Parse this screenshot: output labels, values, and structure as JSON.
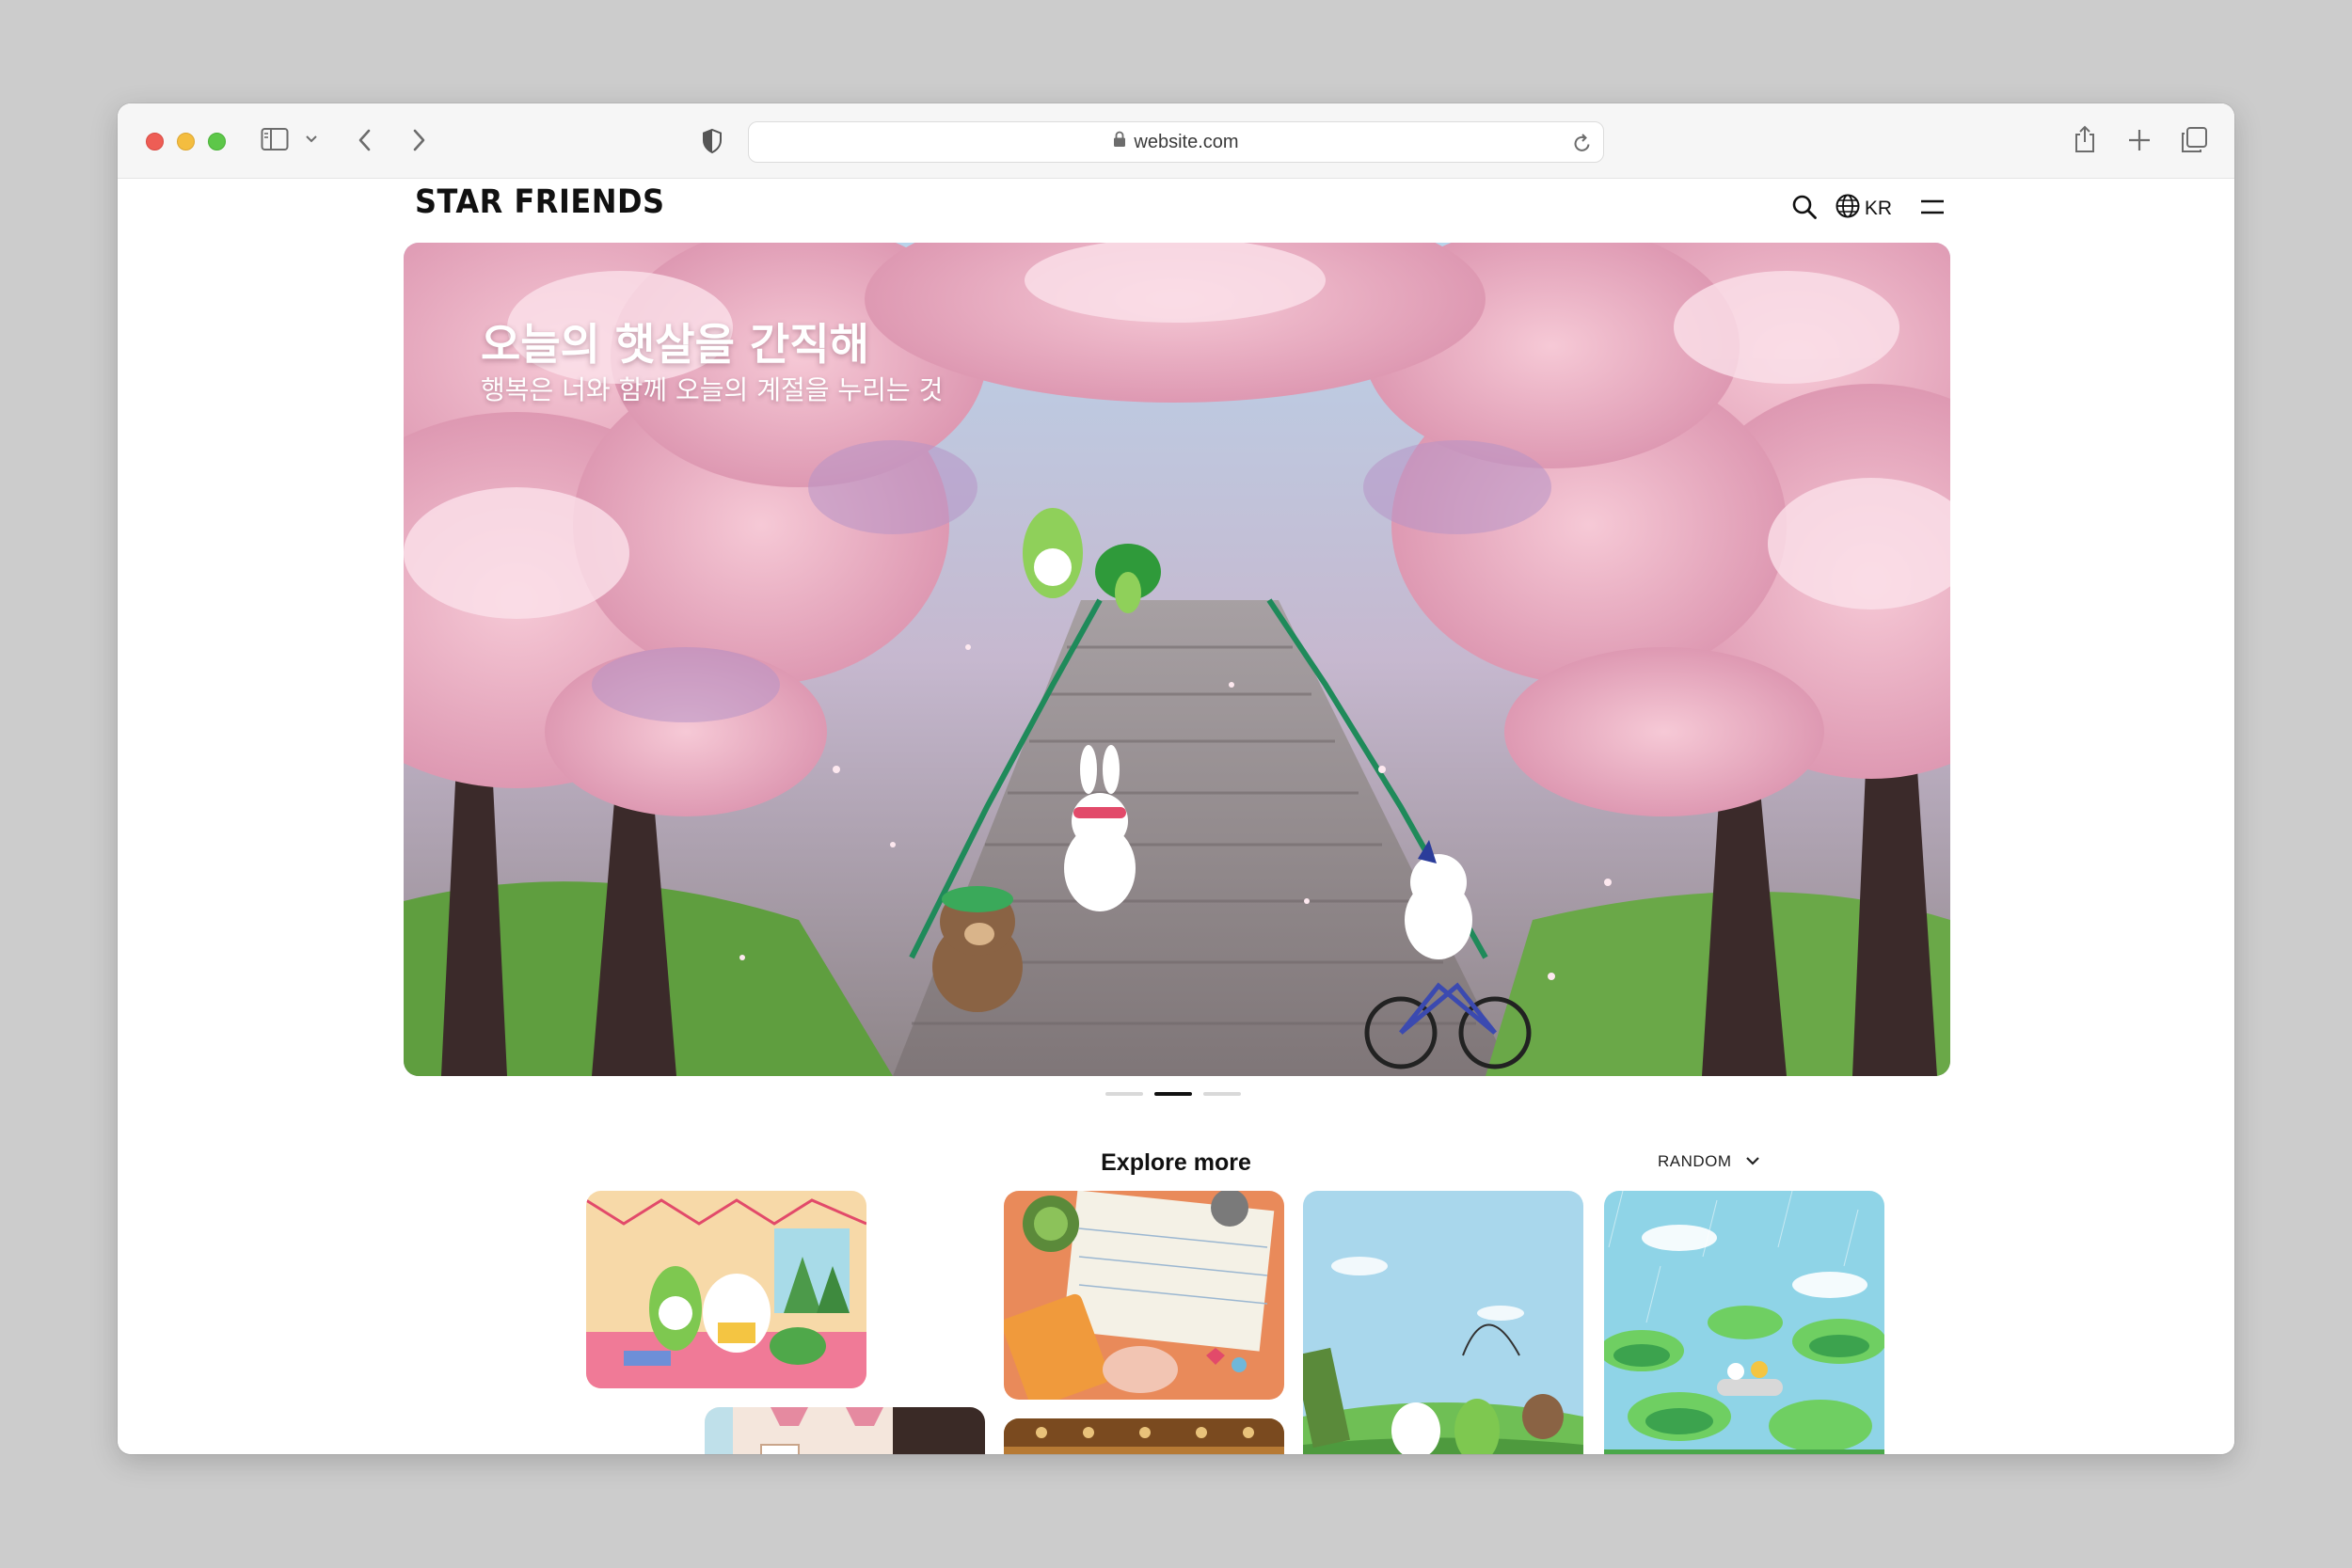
{
  "browser": {
    "url": "website.com",
    "icons": [
      "sidebar-icon",
      "chevron-down-icon",
      "back-icon",
      "forward-icon",
      "shield-icon",
      "lock-icon",
      "reload-icon",
      "share-icon",
      "new-tab-icon",
      "tabs-icon"
    ]
  },
  "site": {
    "logo": "STAR FRIENDS",
    "nav": {
      "language": "KR",
      "icons": [
        "search-icon",
        "globe-icon",
        "menu-icon"
      ]
    }
  },
  "hero": {
    "title": "오늘의 햇살을 간직해",
    "subtitle": "행복은 너와 함께 오늘의 계절을 누리는 것",
    "slide_count": 3,
    "active_slide": 2
  },
  "explore": {
    "title": "Explore more",
    "sort_label": "RANDOM",
    "cards": [
      {
        "name": "card-reading-room",
        "palette": [
          "#f6b8c8",
          "#f4d58d",
          "#7ecf6b"
        ]
      },
      {
        "name": "card-diary-desk",
        "palette": [
          "#f0ecdf",
          "#f28b6a",
          "#6fb7d9"
        ]
      },
      {
        "name": "card-golf-field",
        "palette": [
          "#a8d8ef",
          "#7cc26a",
          "#3f8a3a"
        ]
      },
      {
        "name": "card-rain-lotus",
        "palette": [
          "#8dd3e6",
          "#7fd07a",
          "#2f9a4a"
        ]
      },
      {
        "name": "card-cafe",
        "palette": [
          "#f4e8df",
          "#e58aa0",
          "#3a2a26"
        ]
      },
      {
        "name": "card-antique",
        "palette": [
          "#c48a3d",
          "#7a4a1f",
          "#e9c27a"
        ]
      }
    ]
  }
}
